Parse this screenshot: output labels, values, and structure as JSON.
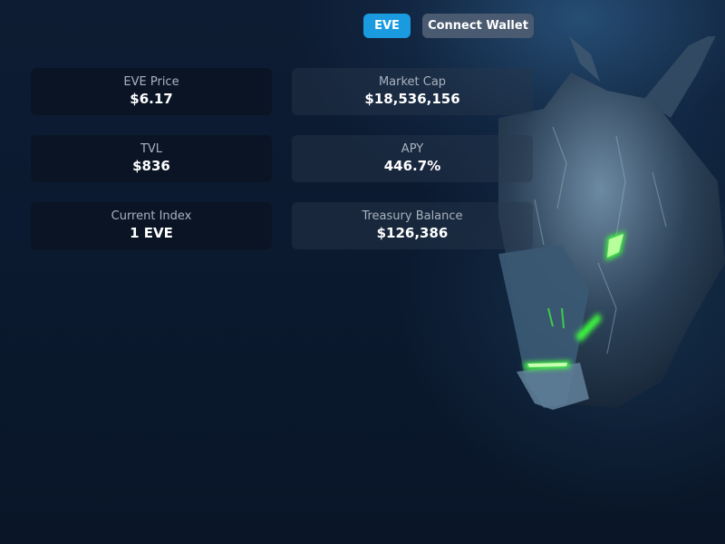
{
  "header": {
    "token_label": "EVE",
    "connect_label": "Connect Wallet"
  },
  "stats": [
    {
      "label": "EVE Price",
      "value": "$6.17"
    },
    {
      "label": "Market Cap",
      "value": "$18,536,156"
    },
    {
      "label": "TVL",
      "value": "$836"
    },
    {
      "label": "APY",
      "value": "446.7%"
    },
    {
      "label": "Current Index",
      "value": "1 EVE"
    },
    {
      "label": "Treasury Balance",
      "value": "$126,386"
    }
  ],
  "theme": {
    "accent": "#1a9be0",
    "wallet_button": "#4a5a70",
    "background": "#0b1a30",
    "glow": "#3cff3c"
  },
  "art": {
    "icon": "dragon-head-icon"
  }
}
